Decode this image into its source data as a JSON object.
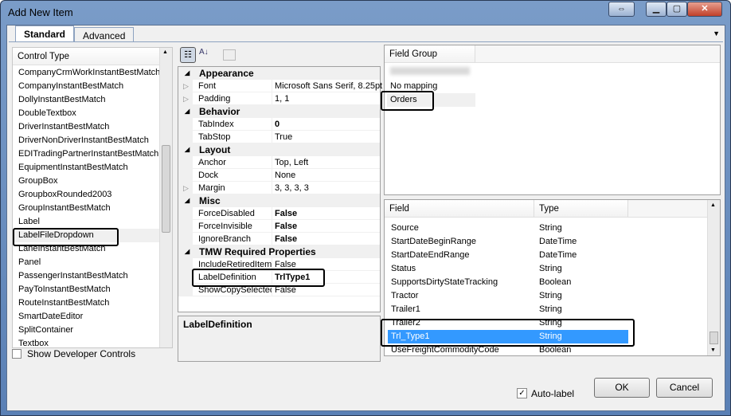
{
  "window": {
    "title": "Add New Item"
  },
  "tabs": [
    "Standard",
    "Advanced"
  ],
  "control_list": {
    "header": "Control Type",
    "items": [
      "CompanyCrmWorkInstantBestMatch",
      "CompanyInstantBestMatch",
      "DollyInstantBestMatch",
      "DoubleTextbox",
      "DriverInstantBestMatch",
      "DriverNonDriverInstantBestMatch",
      "EDITradingPartnerInstantBestMatch",
      "EquipmentInstantBestMatch",
      "GroupBox",
      "GroupboxRounded2003",
      "GroupInstantBestMatch",
      "Label",
      "LabelFileDropdown",
      "LaneInstantBestMatch",
      "Panel",
      "PassengerInstantBestMatch",
      "PayToInstantBestMatch",
      "RouteInstantBestMatch",
      "SmartDateEditor",
      "SplitContainer",
      "Textbox"
    ],
    "selected": "LabelFileDropdown"
  },
  "show_dev_controls": {
    "label": "Show Developer Controls",
    "checked": false
  },
  "properties": [
    {
      "cat": "Appearance"
    },
    {
      "name": "Font",
      "value": "Microsoft Sans Serif, 8.25pt",
      "expand": true
    },
    {
      "name": "Padding",
      "value": "1, 1",
      "expand": true
    },
    {
      "cat": "Behavior"
    },
    {
      "name": "TabIndex",
      "value": "0",
      "bold": true
    },
    {
      "name": "TabStop",
      "value": "True"
    },
    {
      "cat": "Layout"
    },
    {
      "name": "Anchor",
      "value": "Top, Left"
    },
    {
      "name": "Dock",
      "value": "None"
    },
    {
      "name": "Margin",
      "value": "3, 3, 3, 3",
      "expand": true
    },
    {
      "cat": "Misc"
    },
    {
      "name": "ForceDisabled",
      "value": "False",
      "bold": true
    },
    {
      "name": "ForceInvisible",
      "value": "False",
      "bold": true
    },
    {
      "name": "IgnoreBranch",
      "value": "False",
      "bold": true
    },
    {
      "cat": "TMW Required Properties"
    },
    {
      "name": "IncludeRetiredItems",
      "value": "False"
    },
    {
      "name": "LabelDefinition",
      "value": "TrlType1",
      "bold": true
    },
    {
      "name": "ShowCopySelected",
      "value": "False"
    }
  ],
  "description": {
    "title": "LabelDefinition"
  },
  "field_group": {
    "header": "Field Group",
    "items": [
      "No mapping",
      "Orders"
    ],
    "selected": "Orders"
  },
  "fields": {
    "headers": [
      "Field",
      "Type"
    ],
    "rows": [
      [
        "Source",
        "String"
      ],
      [
        "StartDateBeginRange",
        "DateTime"
      ],
      [
        "StartDateEndRange",
        "DateTime"
      ],
      [
        "Status",
        "String"
      ],
      [
        "SupportsDirtyStateTracking",
        "Boolean"
      ],
      [
        "Tractor",
        "String"
      ],
      [
        "Trailer1",
        "String"
      ],
      [
        "Trailer2",
        "String"
      ],
      [
        "Trl_Type1",
        "String"
      ],
      [
        "UseFreightCommodityCode",
        "Boolean"
      ]
    ],
    "selected": "Trl_Type1"
  },
  "auto_label": {
    "label": "Auto-label",
    "checked": true
  },
  "buttons": {
    "ok": "OK",
    "cancel": "Cancel"
  },
  "colors": {
    "selection": "#3399ff"
  }
}
